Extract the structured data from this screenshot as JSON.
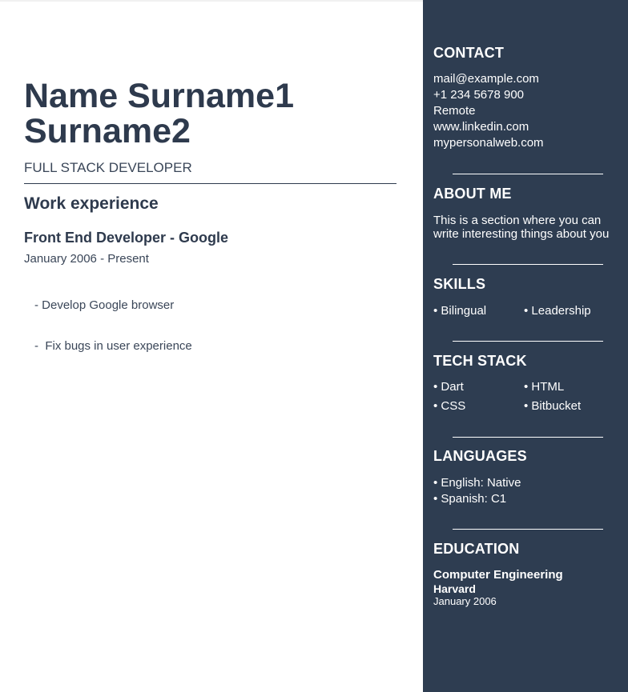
{
  "header": {
    "name_line1": "Name Surname1",
    "name_line2": "Surname2",
    "role": "FULL STACK DEVELOPER"
  },
  "experience": {
    "title": "Work experience",
    "jobs": [
      {
        "title": "Front End Developer - Google",
        "dates": "January 2006 - Present",
        "bullets": [
          "- Develop Google browser",
          "-  Fix bugs in user experience"
        ]
      }
    ]
  },
  "sidebar": {
    "contact": {
      "title": "CONTACT",
      "items": [
        "mail@example.com",
        "+1 234 5678 900",
        "Remote",
        "www.linkedin.com",
        "mypersonalweb.com"
      ]
    },
    "about": {
      "title": "ABOUT ME",
      "lines": [
        "This is a section where you can",
        "write interesting things about you"
      ]
    },
    "skills": {
      "title": "SKILLS",
      "items": [
        "• Bilingual",
        "• Leadership"
      ]
    },
    "tech": {
      "title": "TECH STACK",
      "items": [
        "• Dart",
        "• HTML",
        "• CSS",
        "• Bitbucket"
      ]
    },
    "languages": {
      "title": "LANGUAGES",
      "items": [
        "• English: Native",
        "• Spanish: C1"
      ]
    },
    "education": {
      "title": "EDUCATION",
      "degree": "Computer Engineering",
      "school": "Harvard",
      "date": "January 2006"
    }
  },
  "colors": {
    "sidebar_bg": "#2e3d51",
    "text": "#2e3a4d"
  }
}
